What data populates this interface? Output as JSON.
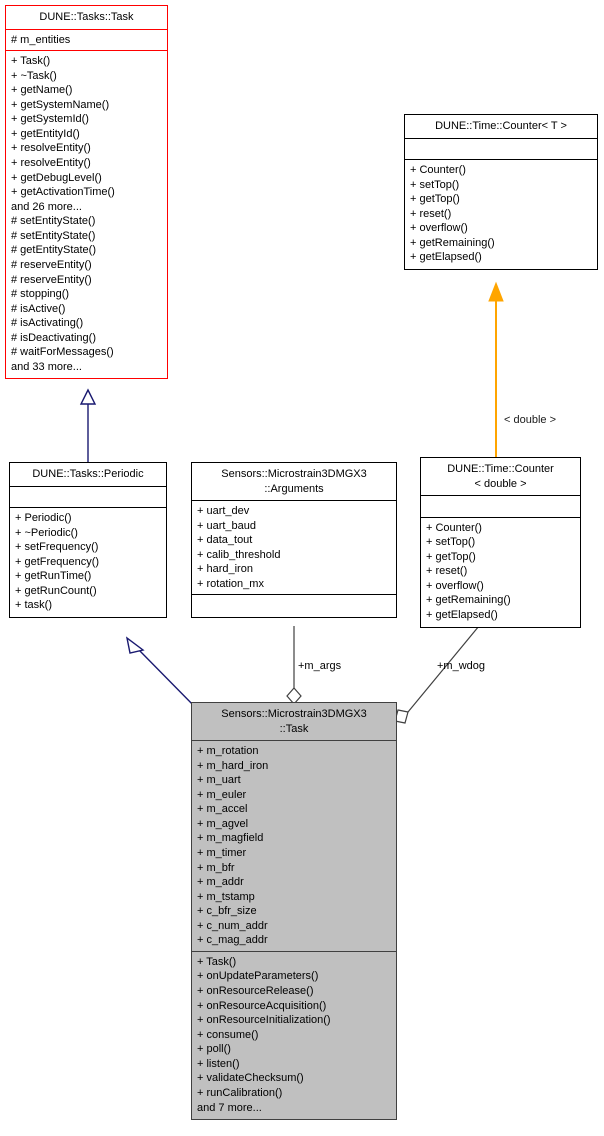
{
  "diagram": {
    "kind": "uml-class-diagram",
    "title": "Sensors::Microstrain3DMGX3::Task collaboration diagram",
    "colors": {
      "highlight_border": "#ff0000",
      "default_border": "#000000",
      "focus_fill": "#c0c0c0",
      "inheritance_edge": "#191970",
      "template_edge": "#ffa500",
      "aggregation_edge": "#404040",
      "background": "#ffffff"
    }
  },
  "classes": {
    "dune_tasks_task": {
      "name": "DUNE::Tasks::Task",
      "attributes": [
        "# m_entities"
      ],
      "operations": [
        "+ Task()",
        "+ ~Task()",
        "+ getName()",
        "+ getSystemName()",
        "+ getSystemId()",
        "+ getEntityId()",
        "+ resolveEntity()",
        "+ resolveEntity()",
        "+ getDebugLevel()",
        "+ getActivationTime()",
        "and 26 more...",
        "# setEntityState()",
        "# setEntityState()",
        "# getEntityState()",
        "# reserveEntity()",
        "# reserveEntity()",
        "# stopping()",
        "# isActive()",
        "# isActivating()",
        "# isDeactivating()",
        "# waitForMessages()",
        "and 33 more..."
      ]
    },
    "counter_t": {
      "name": "DUNE::Time::Counter< T >",
      "attributes": [],
      "operations": [
        "+ Counter()",
        "+ setTop()",
        "+ getTop()",
        "+ reset()",
        "+ overflow()",
        "+ getRemaining()",
        "+ getElapsed()"
      ]
    },
    "dune_tasks_periodic": {
      "name": "DUNE::Tasks::Periodic",
      "attributes": [],
      "operations": [
        "+ Periodic()",
        "+ ~Periodic()",
        "+ setFrequency()",
        "+ getFrequency()",
        "+ getRunTime()",
        "+ getRunCount()",
        "+ task()"
      ]
    },
    "arguments": {
      "name": "Sensors::Microstrain3DMGX3\n::Arguments",
      "attributes": [
        "+ uart_dev",
        "+ uart_baud",
        "+ data_tout",
        "+ calib_threshold",
        "+ hard_iron",
        "+ rotation_mx"
      ],
      "operations": []
    },
    "counter_double": {
      "name": "DUNE::Time::Counter\n< double >",
      "attributes": [],
      "operations": [
        "+ Counter()",
        "+ setTop()",
        "+ getTop()",
        "+ reset()",
        "+ overflow()",
        "+ getRemaining()",
        "+ getElapsed()"
      ]
    },
    "ms3dmgx3_task": {
      "name": "Sensors::Microstrain3DMGX3\n::Task",
      "attributes": [
        "+ m_rotation",
        "+ m_hard_iron",
        "+ m_uart",
        "+ m_euler",
        "+ m_accel",
        "+ m_agvel",
        "+ m_magfield",
        "+ m_timer",
        "+ m_bfr",
        "+ m_addr",
        "+ m_tstamp",
        "+ c_bfr_size",
        "+ c_num_addr",
        "+ c_mag_addr"
      ],
      "operations": [
        "+ Task()",
        "+ onUpdateParameters()",
        "+ onResourceRelease()",
        "+ onResourceAcquisition()",
        "+ onResourceInitialization()",
        "+ consume()",
        "+ poll()",
        "+ listen()",
        "+ validateChecksum()",
        "+ runCalibration()",
        "and 7 more..."
      ]
    }
  },
  "edge_labels": {
    "template_double": "< double >",
    "m_args": "+m_args",
    "m_wdog": "+m_wdog"
  }
}
